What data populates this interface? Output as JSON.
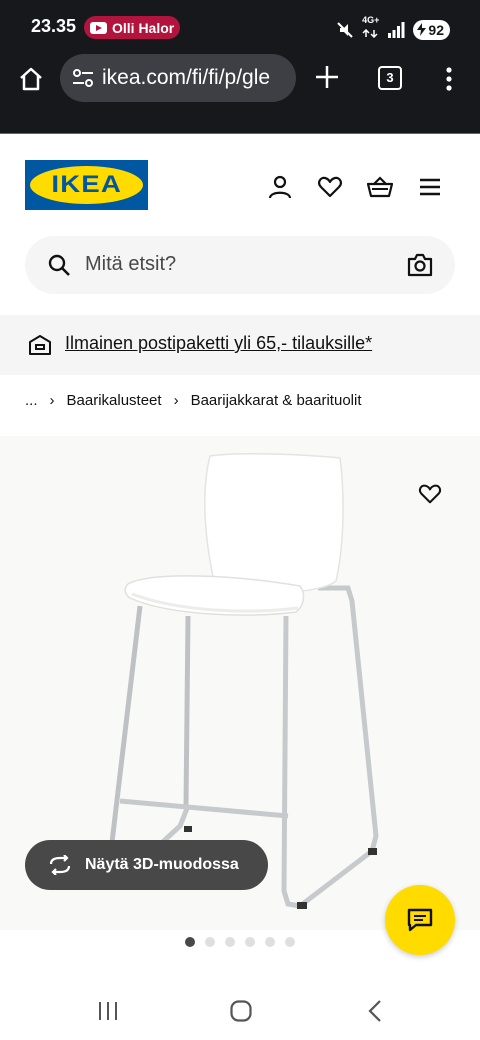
{
  "status_bar": {
    "time": "23.35",
    "notification_text": "Olli Halor",
    "network_top": "4G+",
    "battery_level": "92"
  },
  "browser": {
    "url": "ikea.com/fi/fi/p/gle",
    "tab_count": "3"
  },
  "header": {
    "logo_text": "IKEA"
  },
  "search": {
    "placeholder": "Mitä etsit?"
  },
  "promo": {
    "text": "Ilmainen postipaketti yli 65,- tilauksille*"
  },
  "breadcrumb": {
    "ellipsis": "...",
    "items": [
      "Baarikalusteet",
      "Baarijakkarat & baarituolit"
    ]
  },
  "product": {
    "view_3d_label": "Näytä 3D-muodossa",
    "image_count": 6,
    "active_image_index": 0
  },
  "colors": {
    "ikea_blue": "#0058a3",
    "ikea_yellow": "#ffdb00",
    "dark_chrome": "#17181c",
    "yt_pill": "#b1143d"
  }
}
